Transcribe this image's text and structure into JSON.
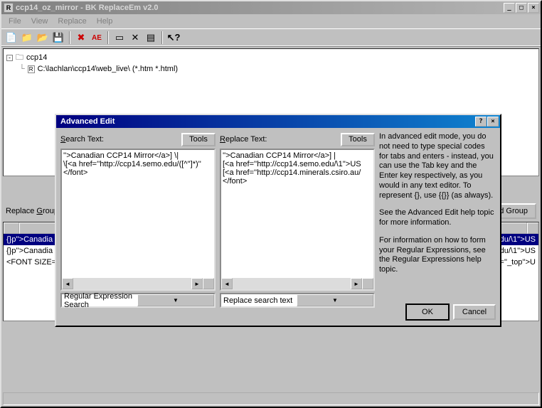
{
  "titlebar": {
    "text": "ccp14_oz_mirror - BK ReplaceEm v2.0"
  },
  "win_controls": {
    "min": "_",
    "max": "□",
    "close": "×",
    "help": "?"
  },
  "menu": {
    "file": "File",
    "view": "View",
    "replace": "Replace",
    "help": "Help"
  },
  "tree": {
    "root": "ccp14",
    "child": "C:\\lachlan\\ccp14\\web_live\\ (*.htm *.html)"
  },
  "group": {
    "label": "Replace Group:",
    "add_btn": "Add Group"
  },
  "list_rows": [
    {
      "search": "{}p''>Canadia",
      "replace": "edu/\\1''>US"
    },
    {
      "search": "{}p''>Canadia",
      "replace": "edu/\\1''>US"
    },
    {
      "search": "<FONT SIZE=",
      "replace": "et=''_top''>U"
    }
  ],
  "dialog": {
    "title": "Advanced Edit",
    "search_label": "Search Text:",
    "replace_label": "Replace Text:",
    "tools_btn": "Tools",
    "search_text": "''>Canadian CCP14 Mirror</a>] \\|\n\\[<a href=''http://ccp14.semo.edu/([^'']*)''\n</font>",
    "replace_text": "''>Canadian CCP14 Mirror</a>] |\n[<a href=''http://ccp14.semo.edu/\\1''>US\n[<a href=''http://ccp14.minerals.csiro.au/\n</font>",
    "search_mode": "Regular Expression Search",
    "replace_mode": "Replace search text",
    "info": "In advanced edit mode, you do not need to type special codes for tabs and enters - instead, you can use the Tab key and the Enter key respectively, as you would in any text editor. To represent {}, use {{}} (as always).",
    "info2": "See the Advanced Edit help topic for more information.",
    "info3": "For information on how to form your Regular Expressions, see the Regular Expressions help topic.",
    "ok": "OK",
    "cancel": "Cancel"
  }
}
